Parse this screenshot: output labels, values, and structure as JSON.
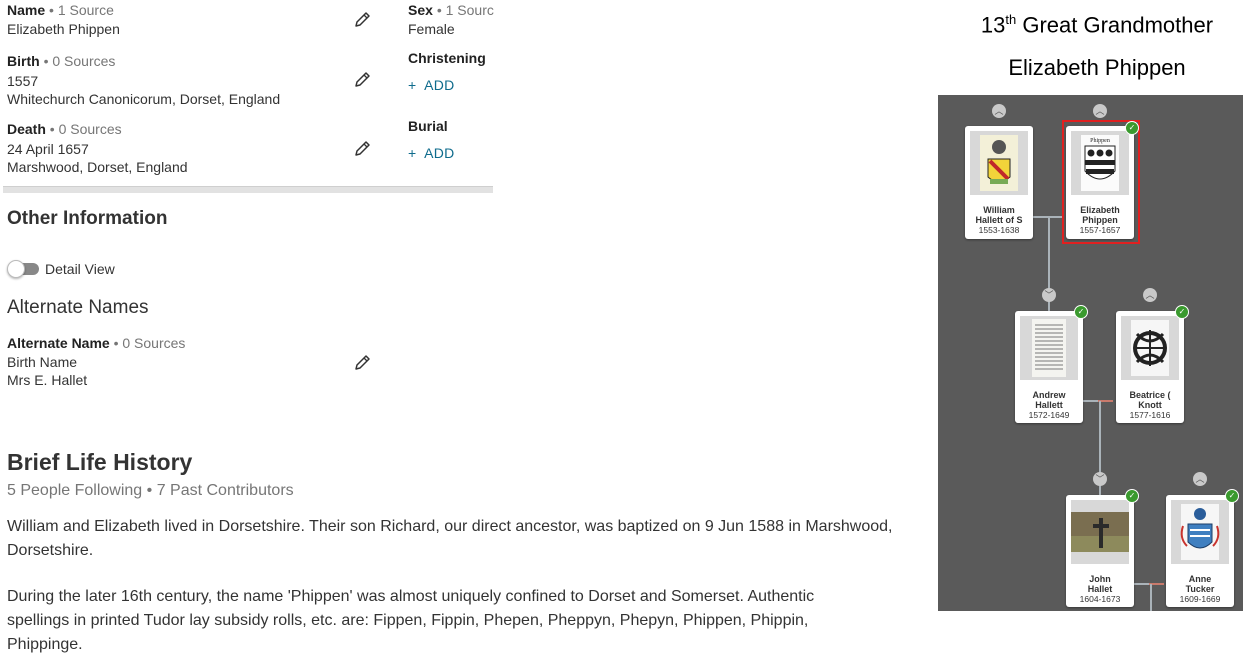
{
  "vitals": {
    "name": {
      "title": "Name",
      "sources": "• 1 Source",
      "value": "Elizabeth Phippen"
    },
    "birth": {
      "title": "Birth",
      "sources": "• 0 Sources",
      "date": "1557",
      "place": "Whitechurch Canonicorum, Dorset, England"
    },
    "death": {
      "title": "Death",
      "sources": "• 0 Sources",
      "date": "24 April 1657",
      "place": "Marshwood, Dorset, England"
    },
    "sex": {
      "title": "Sex",
      "sources": "• 1 Sourc",
      "value": "Female"
    },
    "christening": {
      "title": "Christening",
      "add": "+  ADD"
    },
    "burial": {
      "title": "Burial",
      "add": "+  ADD"
    }
  },
  "other_info": {
    "heading": "Other Information",
    "detail_view_label": "Detail View",
    "alternate_names_heading": "Alternate Names",
    "alternate_name": {
      "title": "Alternate Name",
      "sources": "• 0 Sources",
      "type": "Birth Name",
      "value": "Mrs E. Hallet"
    }
  },
  "life_history": {
    "heading": "Brief Life History",
    "meta": "5 People Following • 7 Past Contributors",
    "paragraph1": "William and Elizabeth lived in Dorsetshire. Their son Richard, our direct ancestor, was baptized on 9 Jun 1588 in Marshwood, Dorsetshire.",
    "paragraph2": "During the later 16th century, the name 'Phippen' was almost uniquely confined to Dorset and Somerset. Authentic spellings in printed Tudor lay subsidy rolls, etc. are: Fippen, Fippin, Phepen, Pheppyn, Phepyn, Phippen, Phippin, Phippinge."
  },
  "panel": {
    "title_num": "13",
    "title_sup": "th",
    "title_rest": " Great Grandmother",
    "subtitle": "Elizabeth Phippen"
  },
  "tree": {
    "colors": {
      "background": "#5a5a5a",
      "highlight": "#e02020",
      "badge": "#3a9a2e"
    },
    "people": [
      {
        "key": "william",
        "name1": "William",
        "name2": "Hallett of S",
        "dates": "1553-1638"
      },
      {
        "key": "elizabeth",
        "name1": "Elizabeth",
        "name2": "Phippen",
        "dates": "1557-1657"
      },
      {
        "key": "andrew",
        "name1": "Andrew",
        "name2": "Hallett",
        "dates": "1572-1649"
      },
      {
        "key": "beatrice",
        "name1": "Beatrice (",
        "name2": "Knott",
        "dates": "1577-1616"
      },
      {
        "key": "john",
        "name1": "John",
        "name2": "Hallet",
        "dates": "1604-1673"
      },
      {
        "key": "anne",
        "name1": "Anne",
        "name2": "Tucker",
        "dates": "1609-1669"
      }
    ]
  }
}
